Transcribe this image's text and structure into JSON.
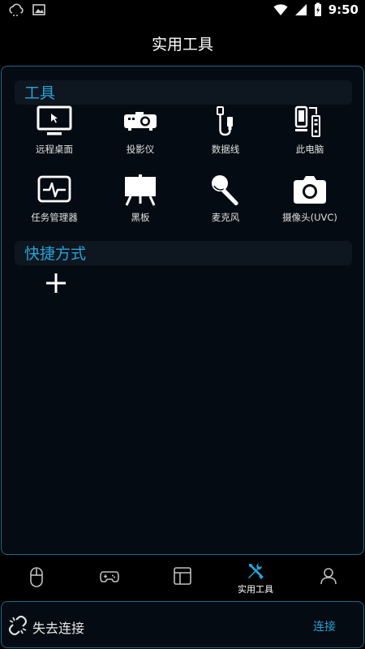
{
  "status_bar": {
    "time": "9:50"
  },
  "page_title": "实用工具",
  "tools_section": {
    "title": "工具",
    "items": [
      {
        "label": "远程桌面",
        "icon": "monitor-icon"
      },
      {
        "label": "投影仪",
        "icon": "projector-icon"
      },
      {
        "label": "数据线",
        "icon": "usb-cable-icon"
      },
      {
        "label": "此电脑",
        "icon": "computer-icon"
      },
      {
        "label": "任务管理器",
        "icon": "task-manager-icon"
      },
      {
        "label": "黑板",
        "icon": "blackboard-icon"
      },
      {
        "label": "麦克风",
        "icon": "microphone-icon"
      },
      {
        "label": "摄像头(UVC)",
        "icon": "camera-icon"
      }
    ]
  },
  "shortcuts_section": {
    "title": "快捷方式"
  },
  "bottom_nav": {
    "items": [
      {
        "label": "",
        "icon": "mouse-icon"
      },
      {
        "label": "",
        "icon": "gamepad-icon"
      },
      {
        "label": "",
        "icon": "layout-icon"
      },
      {
        "label": "实用工具",
        "icon": "tools-icon",
        "active": true
      },
      {
        "label": "",
        "icon": "user-icon"
      }
    ]
  },
  "connection": {
    "status": "失去连接",
    "action": "连接"
  },
  "colors": {
    "accent": "#27a3d6",
    "panel_border": "#1b6a86",
    "background": "#000000"
  }
}
